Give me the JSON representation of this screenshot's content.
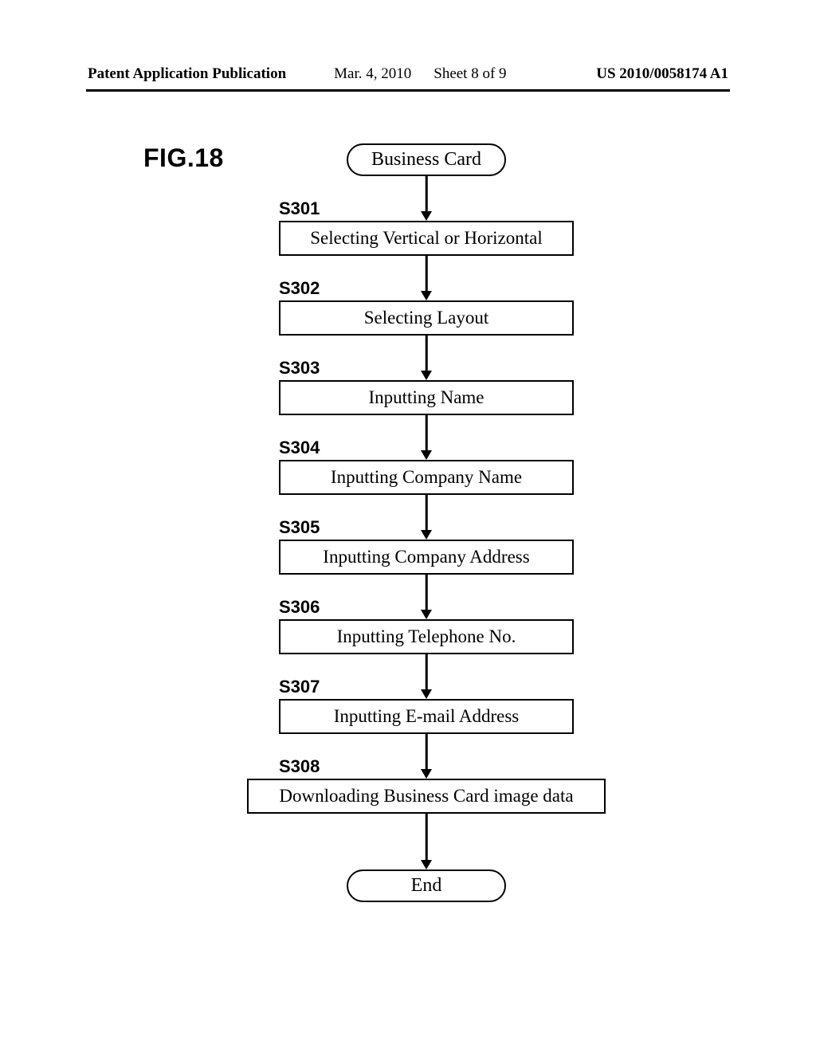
{
  "header": {
    "pub_type": "Patent Application Publication",
    "pub_date": "Mar. 4, 2010",
    "sheet": "Sheet 8 of 9",
    "pub_num": "US 2010/0058174 A1"
  },
  "figure_label": "FIG.18",
  "flow": {
    "start": "Business Card",
    "end": "End",
    "steps": [
      {
        "id": "S301",
        "text": "Selecting Vertical or Horizontal",
        "wide": false
      },
      {
        "id": "S302",
        "text": "Selecting Layout",
        "wide": false
      },
      {
        "id": "S303",
        "text": "Inputting Name",
        "wide": false
      },
      {
        "id": "S304",
        "text": "Inputting Company Name",
        "wide": false
      },
      {
        "id": "S305",
        "text": "Inputting Company Address",
        "wide": false
      },
      {
        "id": "S306",
        "text": "Inputting Telephone No.",
        "wide": false
      },
      {
        "id": "S307",
        "text": "Inputting E-mail Address",
        "wide": false
      },
      {
        "id": "S308",
        "text": "Downloading Business Card image data",
        "wide": true
      }
    ]
  }
}
